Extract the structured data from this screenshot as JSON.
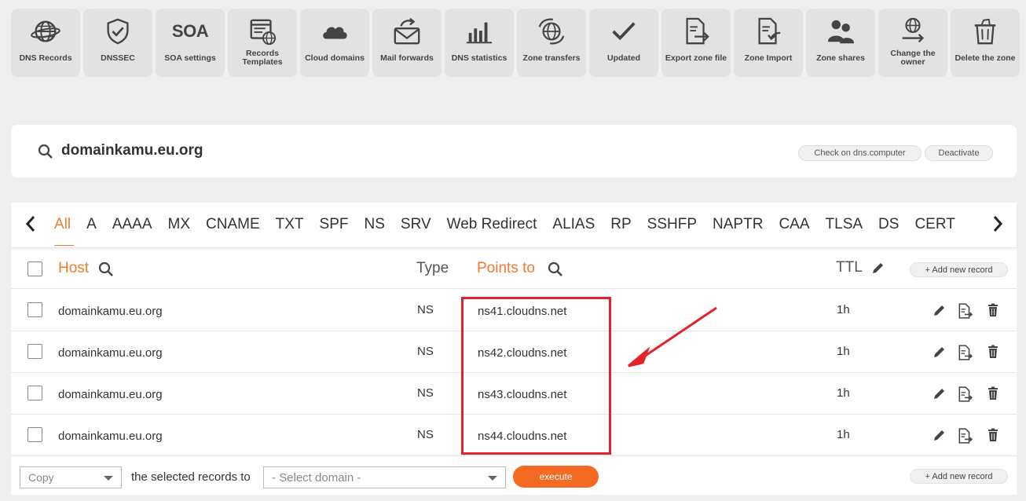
{
  "toolbar": [
    {
      "icon": "globe-icon",
      "label": "DNS Records"
    },
    {
      "icon": "shield-check-icon",
      "label": "DNSSEC"
    },
    {
      "icon": "soa-text-icon",
      "label": "SOA settings",
      "glyph": "SOA"
    },
    {
      "icon": "records-templates-icon",
      "label": "Records Templates"
    },
    {
      "icon": "cloud-icon",
      "label": "Cloud domains"
    },
    {
      "icon": "mail-forward-icon",
      "label": "Mail forwards"
    },
    {
      "icon": "bar-chart-icon",
      "label": "DNS statistics"
    },
    {
      "icon": "zone-transfer-icon",
      "label": "Zone transfers"
    },
    {
      "icon": "checkmark-icon",
      "label": "Updated"
    },
    {
      "icon": "export-file-icon",
      "label": "Export zone file"
    },
    {
      "icon": "import-file-icon",
      "label": "Zone Import"
    },
    {
      "icon": "users-icon",
      "label": "Zone shares"
    },
    {
      "icon": "change-owner-icon",
      "label": "Change the owner"
    },
    {
      "icon": "trash-icon",
      "label": "Delete the zone"
    }
  ],
  "domain": {
    "name": "domainkamu.eu.org",
    "check_label": "Check on dns.computer",
    "deactivate_label": "Deactivate"
  },
  "tabs": [
    "All",
    "A",
    "AAAA",
    "MX",
    "CNAME",
    "TXT",
    "SPF",
    "NS",
    "SRV",
    "Web Redirect",
    "ALIAS",
    "RP",
    "SSHFP",
    "NAPTR",
    "CAA",
    "TLSA",
    "DS",
    "CERT"
  ],
  "table": {
    "headers": {
      "host": "Host",
      "type": "Type",
      "points_to": "Points to",
      "ttl": "TTL"
    },
    "add_new_record": "+ Add new record",
    "rows": [
      {
        "host": "domainkamu.eu.org",
        "type": "NS",
        "points_to": "ns41.cloudns.net",
        "ttl": "1h"
      },
      {
        "host": "domainkamu.eu.org",
        "type": "NS",
        "points_to": "ns42.cloudns.net",
        "ttl": "1h"
      },
      {
        "host": "domainkamu.eu.org",
        "type": "NS",
        "points_to": "ns43.cloudns.net",
        "ttl": "1h"
      },
      {
        "host": "domainkamu.eu.org",
        "type": "NS",
        "points_to": "ns44.cloudns.net",
        "ttl": "1h"
      }
    ]
  },
  "footer": {
    "action_select": "Copy",
    "text": "the selected records to",
    "domain_select": "- Select domain -",
    "execute_label": "execute",
    "add_new_record": "+ Add new record"
  },
  "colors": {
    "accent": "#f07a30",
    "execute": "#f56a22",
    "annotation": "#e3232b"
  }
}
